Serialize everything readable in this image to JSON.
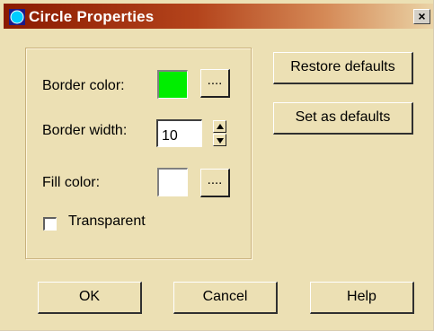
{
  "window": {
    "title": "Circle Properties",
    "app_icon": "circle-app-icon",
    "close_glyph": "×"
  },
  "border": {
    "label": "Border color:",
    "color": "#00ee00",
    "browse_label": "...."
  },
  "width": {
    "label": "Border width:",
    "value": "10"
  },
  "fill": {
    "label": "Fill color:",
    "color": "#ffffff",
    "browse_label": "...."
  },
  "transparent": {
    "label": "Transparent",
    "checked": false
  },
  "side_buttons": {
    "restore_label": "Restore defaults",
    "set_label": "Set as defaults"
  },
  "footer_buttons": {
    "ok_label": "OK",
    "cancel_label": "Cancel",
    "help_label": "Help"
  },
  "colors": {
    "titlebar_start": "#8a1a00",
    "dialog_bg": "#ece0b4"
  }
}
